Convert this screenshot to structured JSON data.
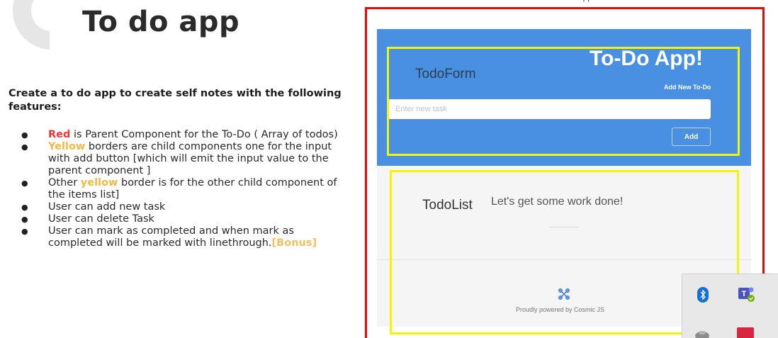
{
  "slide": {
    "title": "To do app",
    "intro": "Create a to do app to create self notes with the following features:",
    "features": [
      {
        "highlight": "Red",
        "highlight_color": "#e53935",
        "text": " is Parent Component for the To-Do ( Array of todos)"
      },
      {
        "highlight": "Yellow",
        "highlight_color": "#f4b942",
        "text": " borders are child components one for the input with add button [which will emit the input value to the parent component ]"
      },
      {
        "prefix": "Other ",
        "highlight": "yellow",
        "highlight_color": "#f4b942",
        "text": " border is for the other child component of the items list]"
      },
      {
        "text": "User can add new task"
      },
      {
        "text": "User can delete Task"
      },
      {
        "text": "User can mark as completed and when mark as completed will be marked with linethrough.",
        "suffix": "[Bonus]"
      }
    ]
  },
  "app": {
    "title": "To-Do App!",
    "form_component_label": "TodoForm",
    "add_new_label": "Add New To-Do",
    "input_placeholder": "Enter new task",
    "input_value": "",
    "add_button_label": "Add",
    "list_component_label": "TodoList",
    "empty_message": "Let's get some work done!",
    "footer_credit": "Proudly powered by Cosmic JS",
    "colors": {
      "header": "#4a90e2",
      "parent_border": "#e10b0b",
      "child_border": "#f5f500"
    }
  },
  "tray": {
    "icons": [
      "bluetooth-icon",
      "teams-icon",
      "usb-icon",
      "acrobat-icon"
    ]
  }
}
